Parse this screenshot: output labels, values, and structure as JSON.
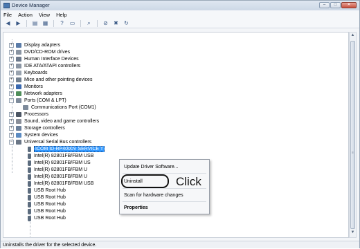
{
  "window": {
    "title": "Device Manager",
    "controls": [
      "–",
      "□",
      "✕"
    ]
  },
  "menu": [
    "File",
    "Action",
    "View",
    "Help"
  ],
  "toolbar": {
    "icons": [
      "back-icon",
      "forward-icon",
      "properties-icon",
      "update-icon",
      "help-icon",
      "monitor-icon",
      "scan-icon",
      "disable-icon",
      "uninstall-icon",
      "enable-icon"
    ]
  },
  "tree": {
    "categories": [
      {
        "label": "Display adapters",
        "state": "+"
      },
      {
        "label": "DVD/CD-ROM drives",
        "state": "+"
      },
      {
        "label": "Human Interface Devices",
        "state": "+"
      },
      {
        "label": "IDE ATA/ATAPI controllers",
        "state": "+"
      },
      {
        "label": "Keyboards",
        "state": "+"
      },
      {
        "label": "Mice and other pointing devices",
        "state": "+"
      },
      {
        "label": "Monitors",
        "state": "+"
      },
      {
        "label": "Network adapters",
        "state": "+"
      },
      {
        "label": "Ports (COM & LPT)",
        "state": "−"
      },
      {
        "label": "Communications Port (COM1)",
        "state": ""
      },
      {
        "label": "Processors",
        "state": "+"
      },
      {
        "label": "Sound, video and game controllers",
        "state": "+"
      },
      {
        "label": "Storage controllers",
        "state": "+"
      },
      {
        "label": "System devices",
        "state": "+"
      },
      {
        "label": "Universal Serial Bus controllers",
        "state": "−"
      }
    ],
    "usb_devices": [
      "ICOM ID-RP4000V SERVICE T",
      "Intel(R) 82801FB/FBM USB",
      "Intel(R) 82801FB/FBM US",
      "Intel(R) 82801FB/FBM U",
      "Intel(R) 82801FB/FBM U",
      "Intel(R) 82801FB/FBM USB",
      "USB Root Hub",
      "USB Root Hub",
      "USB Root Hub",
      "USB Root Hub",
      "USB Root Hub"
    ]
  },
  "context_menu": {
    "update": "Update Driver Software...",
    "uninstall": "Uninstall",
    "scan": "Scan for hardware changes",
    "properties": "Properties"
  },
  "annotation": {
    "click": "Click"
  },
  "status": "Uninstalls the driver for the selected device."
}
